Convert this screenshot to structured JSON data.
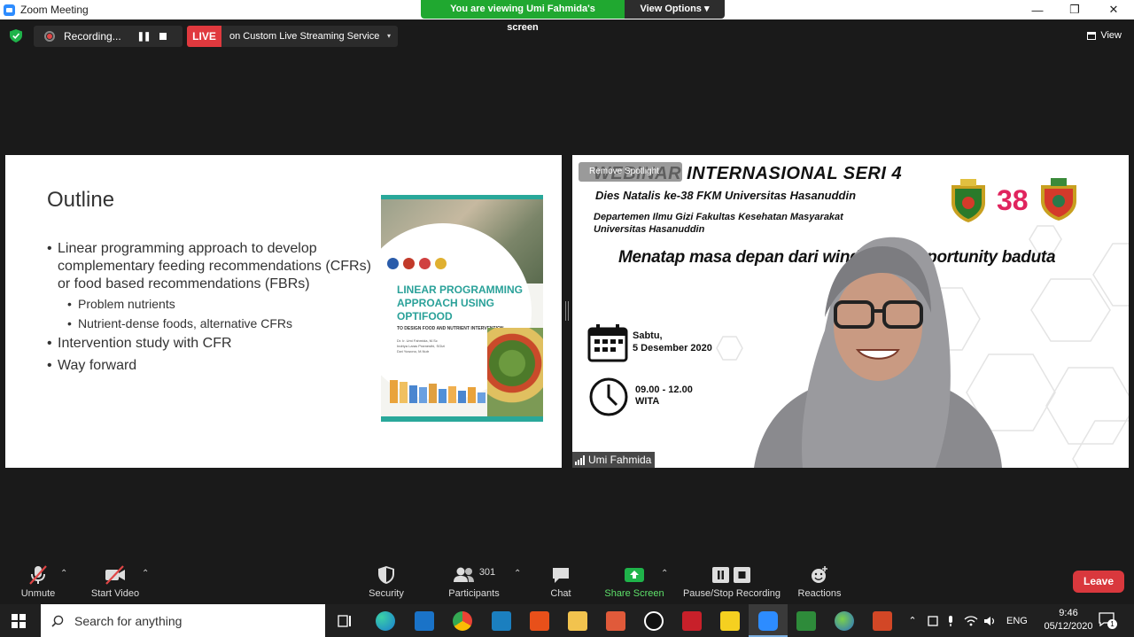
{
  "window": {
    "title": "Zoom Meeting",
    "viewing_banner": "You are viewing Umi Fahmida's screen",
    "view_options": "View Options",
    "view_options_caret": "▾",
    "minimize": "—",
    "restore": "❐",
    "close": "✕"
  },
  "status": {
    "recording_label": "Recording...",
    "live_badge": "LIVE",
    "live_target": "on Custom Live Streaming Service",
    "live_caret": "▾",
    "view_label": "View"
  },
  "slide": {
    "title": "Outline",
    "bullet_char": "•",
    "bullets": {
      "b1": "Linear programming approach to develop complementary feeding recommendations (CFRs) or food based recommendations (FBRs)",
      "b1_sub1": "Problem nutrients",
      "b1_sub2": "Nutrient-dense foods, alternative CFRs",
      "b2": "Intervention study with CFR",
      "b3": "Way forward"
    },
    "book": {
      "title": "LINEAR PROGRAMMING APPROACH USING OPTIFOOD",
      "subtitle": "TO DESIGN FOOD AND NUTRIENT INTERVENTION",
      "authors": [
        "Dr. Ir. Umi Fahmida, M.Sc",
        "Indriya Laras Pramesthi, SGizi",
        "Dwi Yuwono, M.Nutr"
      ]
    }
  },
  "video": {
    "remove_spotlight": "Remove Spotlight",
    "webinar_title": "WEBINAR  INTERNASIONAL SERI 4",
    "dies_natalis": "Dies Natalis ke-38 FKM Universitas Hasanuddin",
    "dept_line1": "Departemen Ilmu Gizi Fakultas Kesehatan Masyarakat",
    "dept_line2": "Universitas Hasanuddin",
    "menatap": "Menatap masa depan dari window of opportunity baduta",
    "day": "Sabtu,",
    "date": "5 Desember 2020",
    "time": "09.00  - 12.00",
    "tz": "WITA",
    "anniversary": "38",
    "participant_name": "Umi Fahmida"
  },
  "toolbar": {
    "unmute": "Unmute",
    "start_video": "Start Video",
    "security": "Security",
    "participants": "Participants",
    "participant_count": "301",
    "chat": "Chat",
    "share_screen": "Share Screen",
    "pause_stop_recording": "Pause/Stop Recording",
    "reactions": "Reactions",
    "leave": "Leave",
    "caret": "⌃"
  },
  "taskbar": {
    "search_placeholder": "Search for anything",
    "language": "ENG",
    "time": "9:46",
    "date": "05/12/2020",
    "notification_count": "1"
  },
  "colors": {
    "accent_green": "#20a830",
    "live_red": "#e0393e",
    "leave_red": "#d9383d",
    "zoom_blue": "#2d8cff",
    "book_teal": "#2aa199"
  }
}
